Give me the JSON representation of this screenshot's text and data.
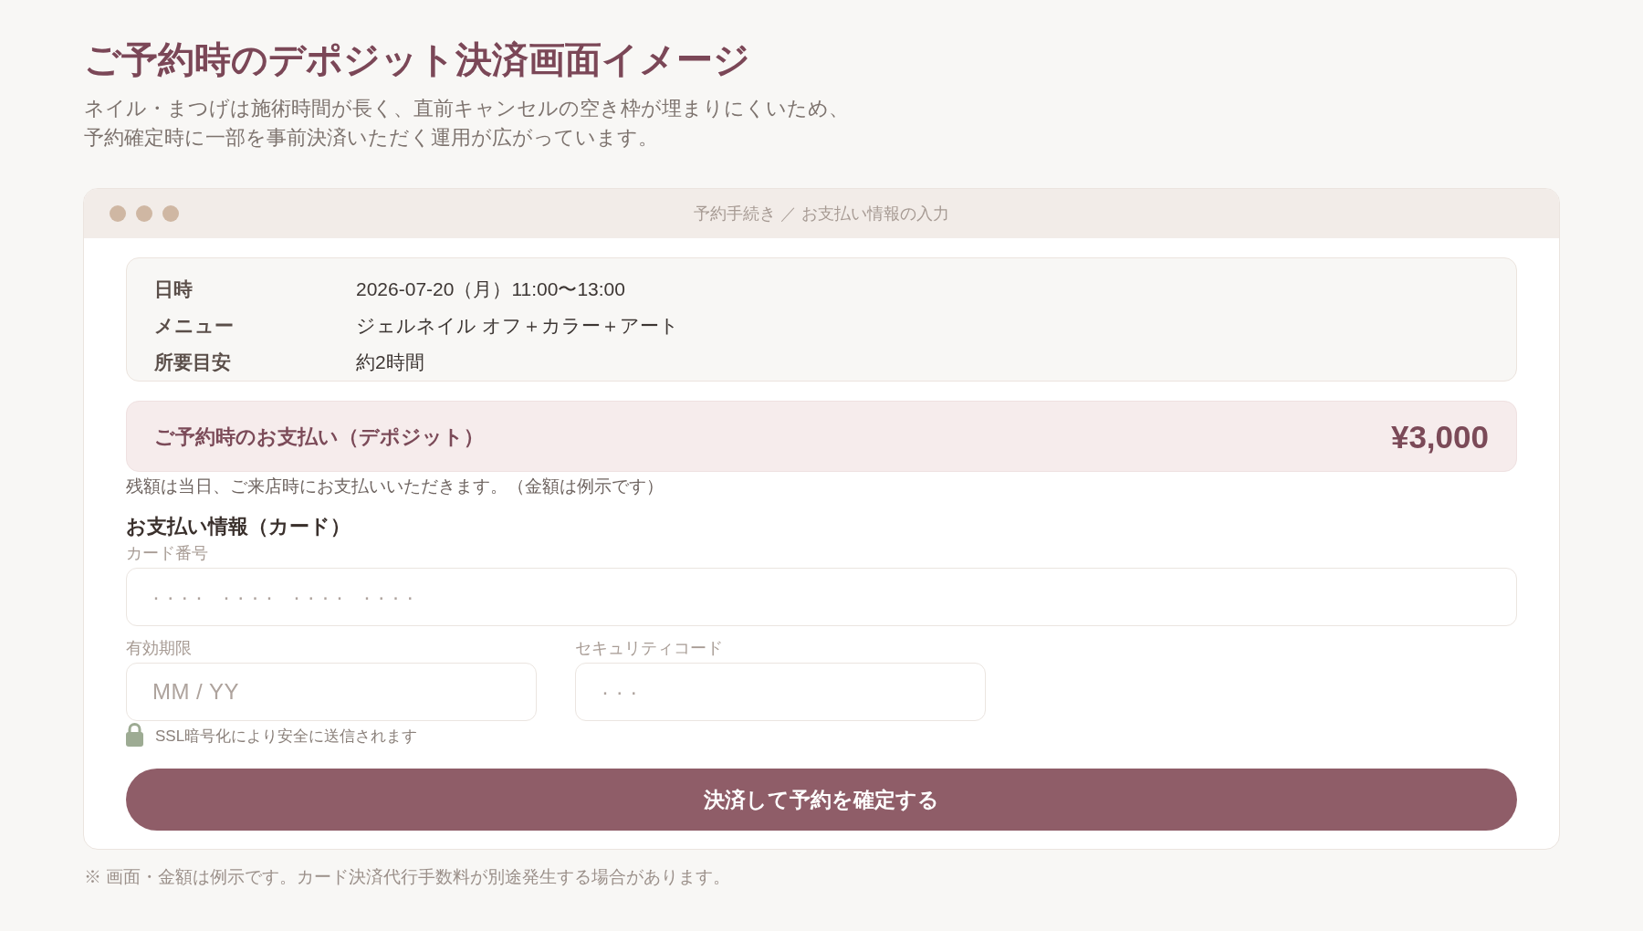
{
  "page": {
    "title": "ご予約時のデポジット決済画面イメージ",
    "intro_lines": [
      "ネイル・まつげは施術時間が長く、直前キャンセルの空き枠が埋まりにくいため、",
      "予約確定時に一部を事前決済いただく運用が広がっています。"
    ]
  },
  "window": {
    "title": "予約手続き ／ お支払い情報の入力",
    "booking_summary": [
      {
        "label": "日時",
        "value": "2026-07-20（月）11:00〜13:00"
      },
      {
        "label": "メニュー",
        "value": "ジェルネイル オフ＋カラー＋アート"
      },
      {
        "label": "所要目安",
        "value": "約2時間"
      }
    ],
    "deposit": {
      "label": "ご予約時のお支払い（デポジット）",
      "amount": "¥3,000",
      "note": "残額は当日、ご来店時にお支払いいただきます。（金額は例示です）"
    },
    "payment_form": {
      "heading": "お支払い情報（カード）",
      "field_rows": [
        {
          "fields": [
            {
              "label": "カード番号",
              "placeholder": "···· ···· ···· ····",
              "kind": "masked"
            }
          ]
        },
        {
          "fields": [
            {
              "label": "有効期限",
              "placeholder": "MM / YY",
              "kind": "text"
            },
            {
              "label": "セキュリティコード",
              "placeholder": "···",
              "kind": "masked"
            }
          ]
        }
      ],
      "security_note": "SSL暗号化により安全に送信されます",
      "submit_button": "決済して予約を確定する"
    }
  },
  "footnote": "※ 画面・金額は例示です。カード決済代行手数料が別途発生する場合があります。"
}
